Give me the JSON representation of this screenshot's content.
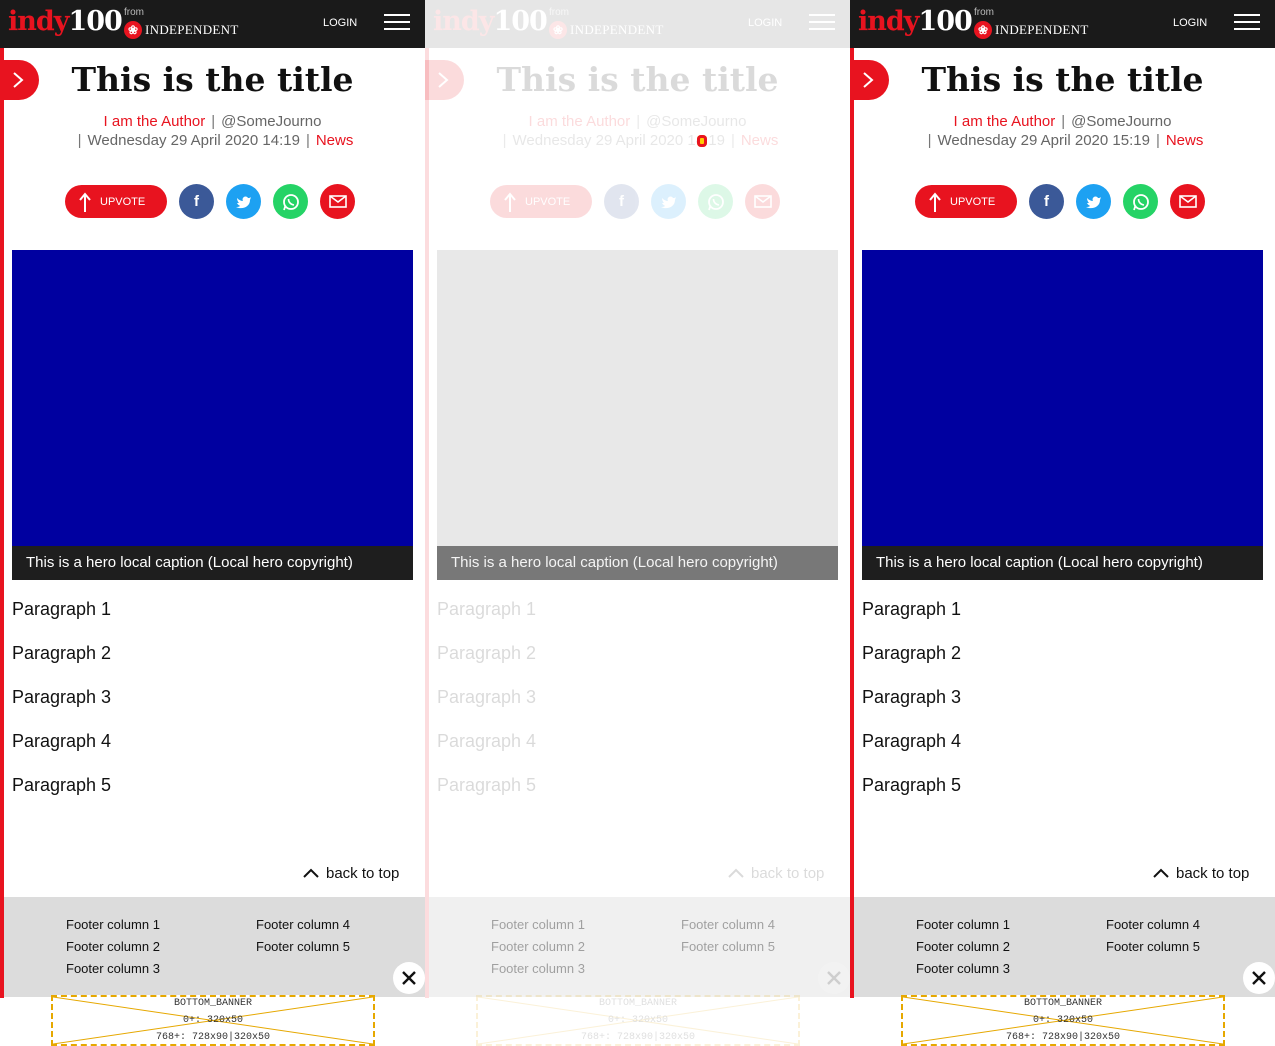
{
  "header": {
    "logo_word": "indy",
    "logo_num": "100",
    "from": "from",
    "publisher": "INDEPENDENT",
    "login": "LOGIN"
  },
  "article": {
    "title": "This is the title",
    "author": "I am the Author",
    "twitter": "@SomeJourno",
    "category": "News",
    "upvote": "UPVOTE",
    "caption": "This is a hero local caption (Local hero copyright)",
    "paragraphs": [
      "Paragraph 1",
      "Paragraph 2",
      "Paragraph 3",
      "Paragraph 4",
      "Paragraph 5"
    ],
    "back_to_top": "back to top"
  },
  "panels": [
    {
      "date": "Wednesday 29 April 2020 14:19"
    },
    {
      "date": "Wednesday 29 April 2020 14:19"
    },
    {
      "date": "Wednesday 29 April 2020 15:19"
    }
  ],
  "footer": {
    "columns": [
      "Footer column 1",
      "Footer column 2",
      "Footer column 3",
      "Footer column 4",
      "Footer column 5"
    ]
  },
  "banner": {
    "line1": "BOTTOM_BANNER",
    "line2": "0+: 320x50",
    "line3": "768+: 728x90|320x50"
  },
  "colors": {
    "brand_red": "#e8131f",
    "hero_blue": "#0000a0",
    "facebook": "#3b5998",
    "twitter": "#1da1f2",
    "whatsapp": "#25d366"
  }
}
